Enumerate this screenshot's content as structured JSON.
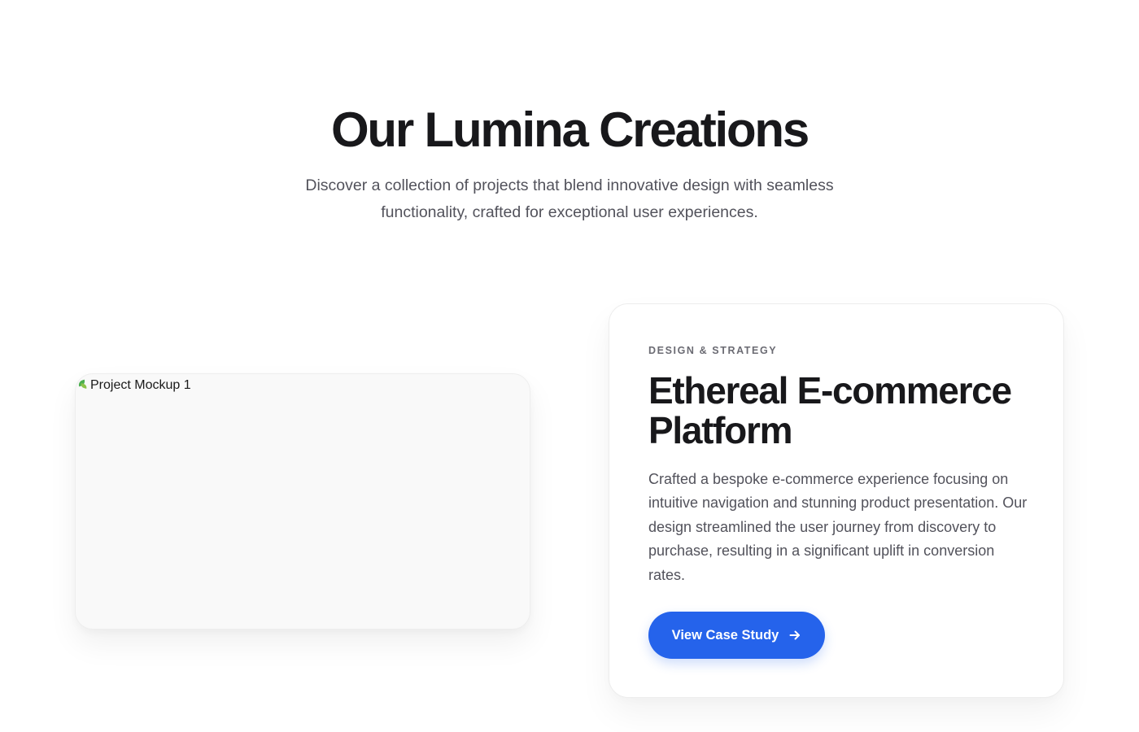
{
  "hero": {
    "title": "Our Lumina Creations",
    "subtitle": "Discover a collection of projects that blend innovative design with seamless functionality, crafted for exceptional user experiences."
  },
  "project": {
    "image_alt": "Project Mockup 1",
    "image_icon": "broken-image-icon",
    "category": "DESIGN & STRATEGY",
    "title": "Ethereal E-commerce Platform",
    "description": "Crafted a bespoke e-commerce experience focusing on intuitive navigation and stunning product presentation. Our design streamlined the user journey from discovery to purchase, resulting in a significant uplift in conversion rates.",
    "cta_label": "View Case Study",
    "cta_icon": "arrow-right-icon"
  },
  "colors": {
    "accent": "#2563eb",
    "heading": "#18181b",
    "body_text": "#52525b",
    "background": "#ffffff"
  }
}
